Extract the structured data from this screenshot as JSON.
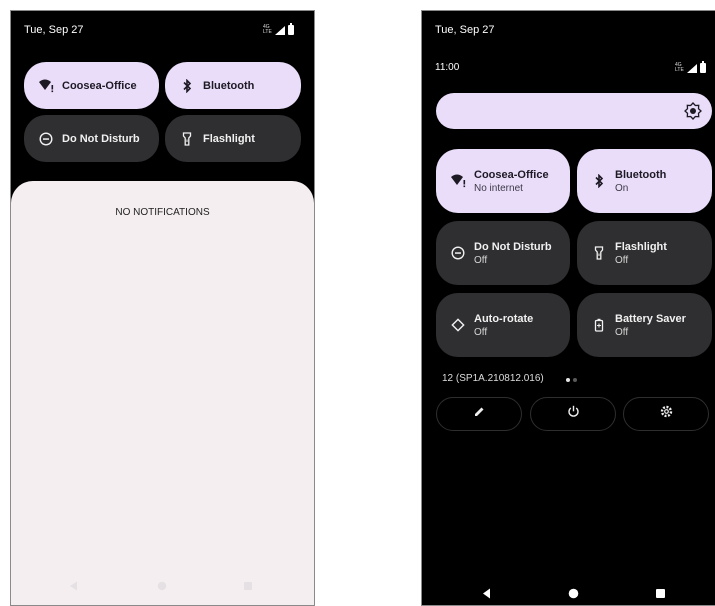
{
  "left": {
    "status": {
      "date": "Tue, Sep 27",
      "lte": "4G LTE"
    },
    "tiles": [
      {
        "label": "Coosea-Office"
      },
      {
        "label": "Bluetooth"
      },
      {
        "label": "Do Not Disturb"
      },
      {
        "label": "Flashlight"
      }
    ],
    "notifications": {
      "empty_text": "NO NOTIFICATIONS"
    }
  },
  "right": {
    "status": {
      "date": "Tue, Sep 27",
      "time": "11:00",
      "lte": "4G LTE"
    },
    "brightness": {
      "icon": "brightness-icon"
    },
    "tiles": [
      {
        "label": "Coosea-Office",
        "state": "No internet"
      },
      {
        "label": "Bluetooth",
        "state": "On"
      },
      {
        "label": "Do Not Disturb",
        "state": "Off"
      },
      {
        "label": "Flashlight",
        "state": "Off"
      },
      {
        "label": "Auto-rotate",
        "state": "Off"
      },
      {
        "label": "Battery Saver",
        "state": "Off"
      }
    ],
    "build": "12 (SP1A.210812.016)",
    "actions": [
      "edit-icon",
      "power-icon",
      "settings-icon"
    ]
  },
  "colors": {
    "tile_on": "#e9ddfa",
    "tile_off": "#2f2f31",
    "panel": "#f4eef0"
  }
}
